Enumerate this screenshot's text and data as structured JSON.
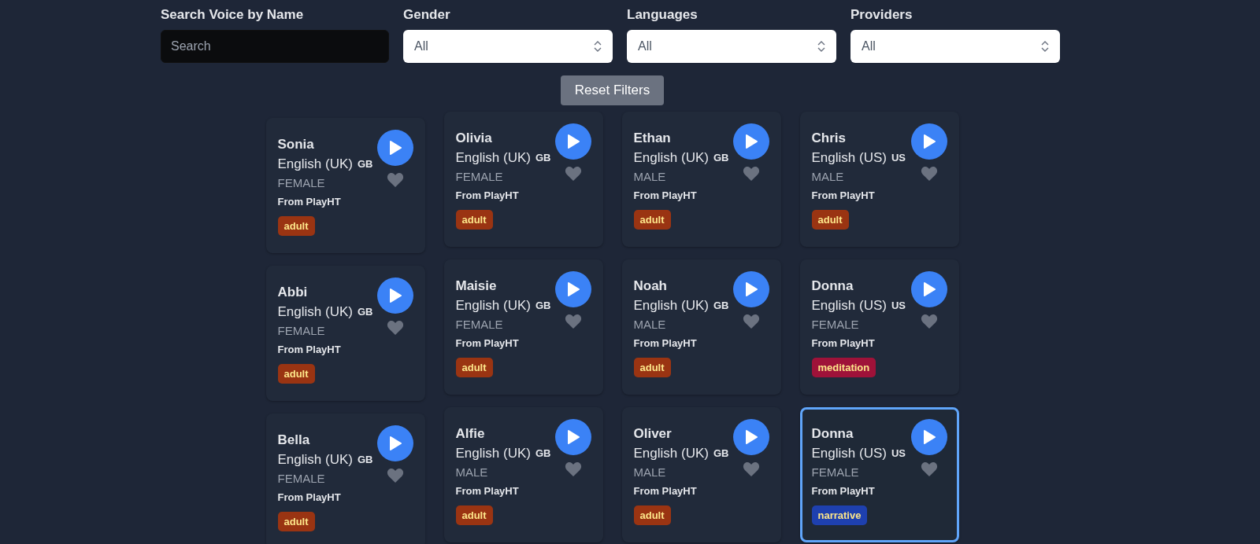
{
  "filters": {
    "search": {
      "label": "Search Voice by Name",
      "placeholder": "Search"
    },
    "selects": [
      {
        "label": "Gender",
        "value": "All"
      },
      {
        "label": "Languages",
        "value": "All"
      },
      {
        "label": "Providers",
        "value": "All"
      }
    ],
    "reset_button": "Reset Filters"
  },
  "voices": [
    {
      "name": "Sonia",
      "language": "English (UK)",
      "country": "GB",
      "gender": "FEMALE",
      "provider": "From PlayHT",
      "tag": "adult",
      "color": "#9a3412",
      "selected": false
    },
    {
      "name": "Olivia",
      "language": "English (UK)",
      "country": "GB",
      "gender": "FEMALE",
      "provider": "From PlayHT",
      "tag": "adult",
      "color": "#9a3412",
      "selected": false
    },
    {
      "name": "Ethan",
      "language": "English (UK)",
      "country": "GB",
      "gender": "MALE",
      "provider": "From PlayHT",
      "tag": "adult",
      "color": "#9a3412",
      "selected": false
    },
    {
      "name": "Chris",
      "language": "English (US)",
      "country": "US",
      "gender": "MALE",
      "provider": "From PlayHT",
      "tag": "adult",
      "color": "#9a3412",
      "selected": false
    },
    {
      "name": "Abbi",
      "language": "English (UK)",
      "country": "GB",
      "gender": "FEMALE",
      "provider": "From PlayHT",
      "tag": "adult",
      "color": "#9a3412",
      "selected": false
    },
    {
      "name": "Maisie",
      "language": "English (UK)",
      "country": "GB",
      "gender": "FEMALE",
      "provider": "From PlayHT",
      "tag": "adult",
      "color": "#9a3412",
      "selected": false
    },
    {
      "name": "Noah",
      "language": "English (UK)",
      "country": "GB",
      "gender": "MALE",
      "provider": "From PlayHT",
      "tag": "adult",
      "color": "#9a3412",
      "selected": false
    },
    {
      "name": "Donna",
      "language": "English (US)",
      "country": "US",
      "gender": "FEMALE",
      "provider": "From PlayHT",
      "tag": "meditation",
      "color": "#9f1239",
      "selected": false
    },
    {
      "name": "Bella",
      "language": "English (UK)",
      "country": "GB",
      "gender": "FEMALE",
      "provider": "From PlayHT",
      "tag": "adult",
      "color": "#9a3412",
      "selected": false
    },
    {
      "name": "Alfie",
      "language": "English (UK)",
      "country": "GB",
      "gender": "MALE",
      "provider": "From PlayHT",
      "tag": "adult",
      "color": "#9a3412",
      "selected": false
    },
    {
      "name": "Oliver",
      "language": "English (UK)",
      "country": "GB",
      "gender": "MALE",
      "provider": "From PlayHT",
      "tag": "adult",
      "color": "#9a3412",
      "selected": false
    },
    {
      "name": "Donna",
      "language": "English (US)",
      "country": "US",
      "gender": "FEMALE",
      "provider": "From PlayHT",
      "tag": "narrative",
      "color": "#1e40af",
      "selected": true
    }
  ]
}
